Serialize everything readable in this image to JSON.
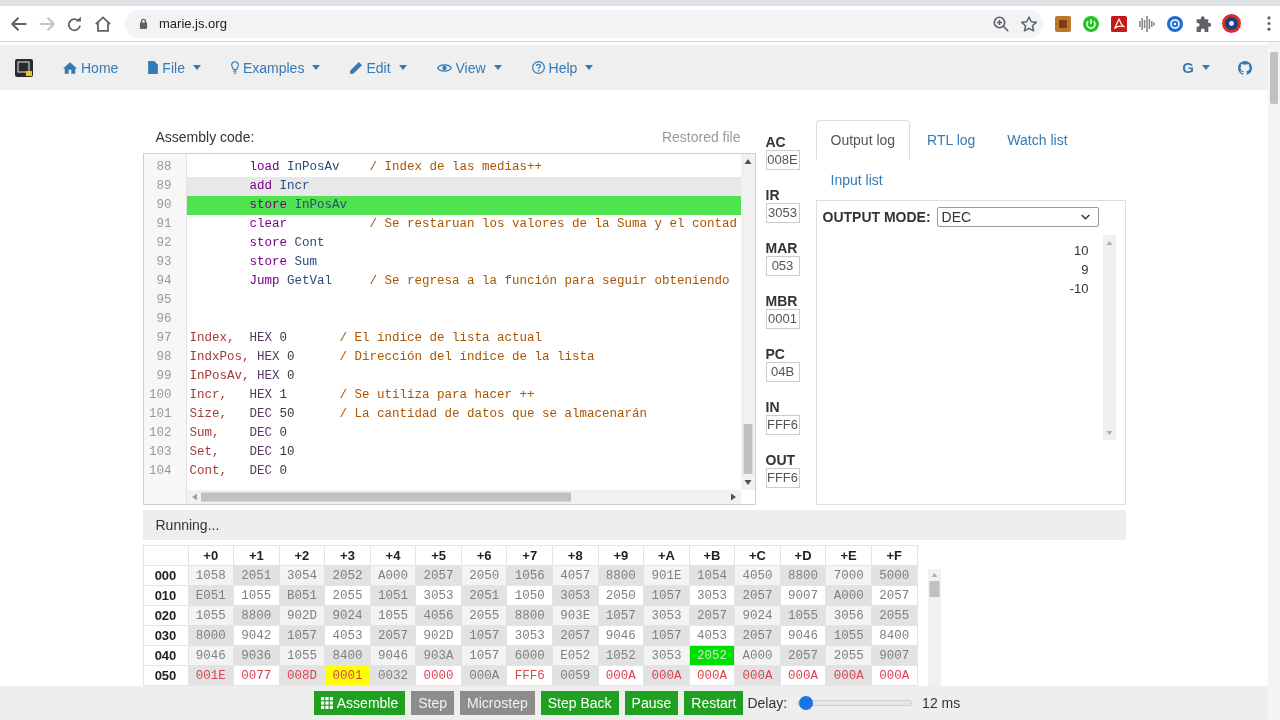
{
  "browser": {
    "url": "marie.js.org",
    "can_go_back": true,
    "can_go_forward": false
  },
  "nav": {
    "items": [
      {
        "label": "Home",
        "dropdown": false
      },
      {
        "label": "File",
        "dropdown": true
      },
      {
        "label": "Examples",
        "dropdown": true
      },
      {
        "label": "Edit",
        "dropdown": true
      },
      {
        "label": "View",
        "dropdown": true
      },
      {
        "label": "Help",
        "dropdown": true
      }
    ],
    "language": {
      "label": "G",
      "dropdown": true
    }
  },
  "editor": {
    "title": "Assembly code:",
    "file_status": "Restored file",
    "lines": [
      {
        "number": "88",
        "instruction": "load",
        "operand": "InPosAv",
        "comment": "/ Index de las medias++",
        "current": false,
        "cursor": false
      },
      {
        "number": "89",
        "instruction": "add",
        "operand": "Incr",
        "current": false,
        "cursor": true
      },
      {
        "number": "90",
        "instruction": "store",
        "operand": "InPosAv",
        "current": true,
        "cursor": false
      },
      {
        "number": "91",
        "instruction": "clear",
        "comment": "/ Se restaruan los valores de la Suma y el contad",
        "current": false,
        "cursor": false
      },
      {
        "number": "92",
        "instruction": "store",
        "operand": "Cont",
        "current": false,
        "cursor": false
      },
      {
        "number": "93",
        "instruction": "store",
        "operand": "Sum",
        "current": false,
        "cursor": false
      },
      {
        "number": "94",
        "instruction": "Jump",
        "operand": "GetVal",
        "comment": "/ Se regresa a la función para seguir obteniendo",
        "current": false,
        "cursor": false
      },
      {
        "number": "95",
        "current": false,
        "cursor": false
      },
      {
        "number": "96",
        "current": false,
        "cursor": false
      },
      {
        "number": "97",
        "label": "Index,",
        "instruction": "HEX",
        "operand": "0",
        "comment": "/ El índice de lista actual",
        "current": false,
        "cursor": false
      },
      {
        "number": "98",
        "label": "IndxPos,",
        "instruction": "HEX",
        "operand": "0",
        "comment": "/ Dirección del índice de la lista",
        "current": false,
        "cursor": false
      },
      {
        "number": "99",
        "label": "InPosAv,",
        "instruction": "HEX",
        "operand": "0",
        "current": false,
        "cursor": false
      },
      {
        "number": "100",
        "label": "Incr,",
        "instruction": "HEX",
        "operand": "1",
        "comment": "/ Se utiliza para hacer ++",
        "current": false,
        "cursor": false
      },
      {
        "number": "101",
        "label": "Size,",
        "instruction": "DEC",
        "operand": "50",
        "comment": "/ La cantidad de datos que se almacenarán",
        "current": false,
        "cursor": false
      },
      {
        "number": "102",
        "label": "Sum,",
        "instruction": "DEC",
        "operand": "0",
        "current": false,
        "cursor": false
      },
      {
        "number": "103",
        "label": "Set,",
        "instruction": "DEC",
        "operand": "10",
        "current": false,
        "cursor": false
      },
      {
        "number": "104",
        "label": "Cont,",
        "instruction": "DEC",
        "operand": "0",
        "current": false,
        "cursor": false
      }
    ]
  },
  "registers": [
    {
      "name": "AC",
      "value": "008E"
    },
    {
      "name": "IR",
      "value": "3053"
    },
    {
      "name": "MAR",
      "value": "053"
    },
    {
      "name": "MBR",
      "value": "0001"
    },
    {
      "name": "PC",
      "value": "04B"
    },
    {
      "name": "IN",
      "value": "FFF6"
    },
    {
      "name": "OUT",
      "value": "FFF6"
    }
  ],
  "output_panel": {
    "tabs": [
      {
        "label": "Output log",
        "selected": true
      },
      {
        "label": "RTL log",
        "selected": false
      },
      {
        "label": "Watch list",
        "selected": false
      },
      {
        "label": "Input list",
        "selected": false
      }
    ],
    "mode_label": "OUTPUT MODE:",
    "mode": "DEC",
    "log": [
      "10",
      "9",
      "-10"
    ]
  },
  "status": "Running...",
  "memory": {
    "columns": [
      "+0",
      "+1",
      "+2",
      "+3",
      "+4",
      "+5",
      "+6",
      "+7",
      "+8",
      "+9",
      "+A",
      "+B",
      "+C",
      "+D",
      "+E",
      "+F"
    ],
    "rows": [
      {
        "address": "000",
        "cells": [
          {
            "value": "1058",
            "changed": false
          },
          {
            "value": "2051",
            "changed": false
          },
          {
            "value": "3054",
            "changed": false
          },
          {
            "value": "2052",
            "changed": false
          },
          {
            "value": "A000",
            "changed": false
          },
          {
            "value": "2057",
            "changed": false
          },
          {
            "value": "2050",
            "changed": false
          },
          {
            "value": "1056",
            "changed": false
          },
          {
            "value": "4057",
            "changed": false
          },
          {
            "value": "8800",
            "changed": false
          },
          {
            "value": "901E",
            "changed": false
          },
          {
            "value": "1054",
            "changed": false
          },
          {
            "value": "4050",
            "changed": false
          },
          {
            "value": "8800",
            "changed": false
          },
          {
            "value": "7000",
            "changed": false
          },
          {
            "value": "5000",
            "changed": false
          }
        ]
      },
      {
        "address": "010",
        "cells": [
          {
            "value": "E051",
            "changed": false
          },
          {
            "value": "1055",
            "changed": false
          },
          {
            "value": "B051",
            "changed": false
          },
          {
            "value": "2055",
            "changed": false
          },
          {
            "value": "1051",
            "changed": false
          },
          {
            "value": "3053",
            "changed": false
          },
          {
            "value": "2051",
            "changed": false
          },
          {
            "value": "1050",
            "changed": false
          },
          {
            "value": "3053",
            "changed": false
          },
          {
            "value": "2050",
            "changed": false
          },
          {
            "value": "1057",
            "changed": false
          },
          {
            "value": "3053",
            "changed": false
          },
          {
            "value": "2057",
            "changed": false
          },
          {
            "value": "9007",
            "changed": false
          },
          {
            "value": "A000",
            "changed": false
          },
          {
            "value": "2057",
            "changed": false
          }
        ]
      },
      {
        "address": "020",
        "cells": [
          {
            "value": "1055",
            "changed": false
          },
          {
            "value": "8800",
            "changed": false
          },
          {
            "value": "902D",
            "changed": false
          },
          {
            "value": "9024",
            "changed": false
          },
          {
            "value": "1055",
            "changed": false
          },
          {
            "value": "4056",
            "changed": false
          },
          {
            "value": "2055",
            "changed": false
          },
          {
            "value": "8800",
            "changed": false
          },
          {
            "value": "903E",
            "changed": false
          },
          {
            "value": "1057",
            "changed": false
          },
          {
            "value": "3053",
            "changed": false
          },
          {
            "value": "2057",
            "changed": false
          },
          {
            "value": "9024",
            "changed": false
          },
          {
            "value": "1055",
            "changed": false
          },
          {
            "value": "3056",
            "changed": false
          },
          {
            "value": "2055",
            "changed": false
          }
        ]
      },
      {
        "address": "030",
        "cells": [
          {
            "value": "8000",
            "changed": false
          },
          {
            "value": "9042",
            "changed": false
          },
          {
            "value": "1057",
            "changed": false
          },
          {
            "value": "4053",
            "changed": false
          },
          {
            "value": "2057",
            "changed": false
          },
          {
            "value": "902D",
            "changed": false
          },
          {
            "value": "1057",
            "changed": false
          },
          {
            "value": "3053",
            "changed": false
          },
          {
            "value": "2057",
            "changed": false
          },
          {
            "value": "9046",
            "changed": false
          },
          {
            "value": "1057",
            "changed": false
          },
          {
            "value": "4053",
            "changed": false
          },
          {
            "value": "2057",
            "changed": false
          },
          {
            "value": "9046",
            "changed": false
          },
          {
            "value": "1055",
            "changed": false
          },
          {
            "value": "8400",
            "changed": false
          }
        ]
      },
      {
        "address": "040",
        "cells": [
          {
            "value": "9046",
            "changed": false
          },
          {
            "value": "9036",
            "changed": false
          },
          {
            "value": "1055",
            "changed": false
          },
          {
            "value": "8400",
            "changed": false
          },
          {
            "value": "9046",
            "changed": false
          },
          {
            "value": "903A",
            "changed": false
          },
          {
            "value": "1057",
            "changed": false
          },
          {
            "value": "6000",
            "changed": false
          },
          {
            "value": "E052",
            "changed": false
          },
          {
            "value": "1052",
            "changed": false
          },
          {
            "value": "3053",
            "changed": false
          },
          {
            "value": "2052",
            "changed": false
          },
          {
            "value": "A000",
            "changed": false
          },
          {
            "value": "2057",
            "changed": false
          },
          {
            "value": "2055",
            "changed": false
          },
          {
            "value": "9007",
            "changed": false
          }
        ]
      },
      {
        "address": "050",
        "cells": [
          {
            "value": "001E",
            "changed": true
          },
          {
            "value": "0077",
            "changed": true
          },
          {
            "value": "008D",
            "changed": true
          },
          {
            "value": "0001",
            "changed": true
          },
          {
            "value": "0032",
            "changed": false
          },
          {
            "value": "0000",
            "changed": true
          },
          {
            "value": "000A",
            "changed": false
          },
          {
            "value": "FFF6",
            "changed": true
          },
          {
            "value": "0059",
            "changed": false
          },
          {
            "value": "000A",
            "changed": true
          },
          {
            "value": "000A",
            "changed": true
          },
          {
            "value": "000A",
            "changed": true
          },
          {
            "value": "000A",
            "changed": true
          },
          {
            "value": "000A",
            "changed": true
          },
          {
            "value": "000A",
            "changed": true
          },
          {
            "value": "000A",
            "changed": true
          }
        ]
      }
    ]
  },
  "controls": {
    "buttons": [
      {
        "label": "Assemble",
        "disabled": false
      },
      {
        "label": "Step",
        "disabled": true
      },
      {
        "label": "Microstep",
        "disabled": true
      },
      {
        "label": "Step Back",
        "disabled": false
      },
      {
        "label": "Pause",
        "disabled": false
      },
      {
        "label": "Restart",
        "disabled": false
      }
    ],
    "delay": {
      "label": "Delay:",
      "level": 0.01,
      "reading": "12 ms"
    }
  }
}
